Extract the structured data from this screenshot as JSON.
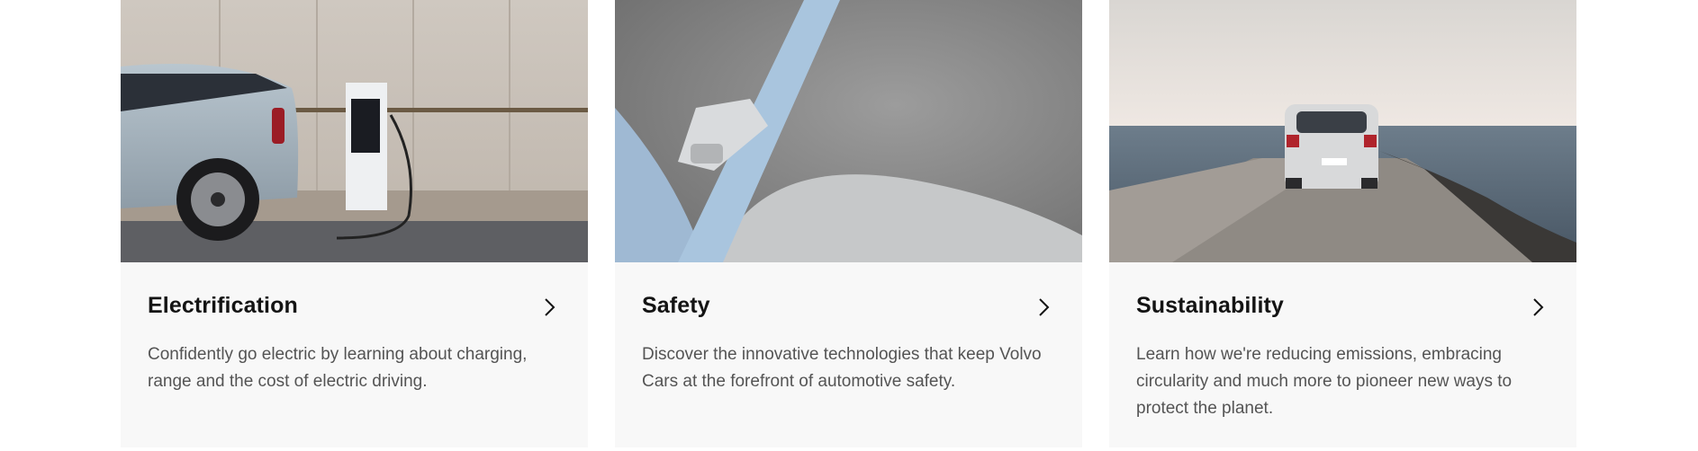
{
  "cards": [
    {
      "title": "Electrification",
      "description": "Confidently go electric by learning about charging, range and the cost of electric driving.",
      "image": "electric-car-charging-photo",
      "icon": "chevron-right-icon"
    },
    {
      "title": "Safety",
      "description": "Discover the innovative technologies that keep Volvo Cars at the forefront of automotive safety.",
      "image": "seat-belt-photo",
      "icon": "chevron-right-icon"
    },
    {
      "title": "Sustainability",
      "description": "Learn how we're reducing emissions, embracing circularity and much more to pioneer new ways to protect the planet.",
      "image": "suv-on-pier-photo",
      "icon": "chevron-right-icon"
    }
  ],
  "colors": {
    "card_background": "#f8f8f8",
    "title": "#141414",
    "description": "#545454"
  }
}
